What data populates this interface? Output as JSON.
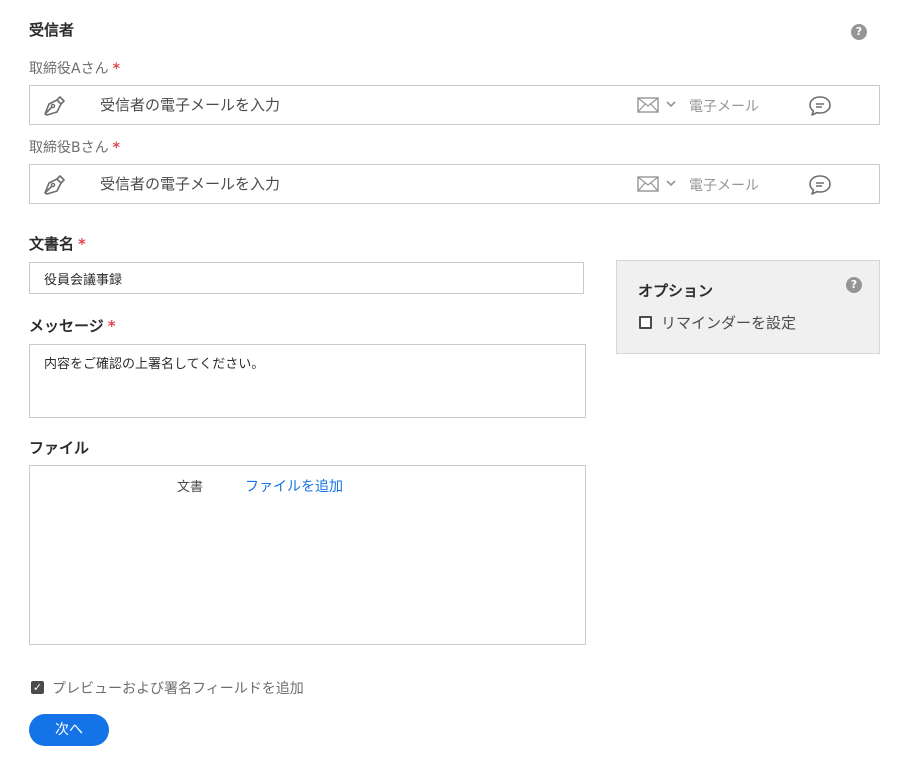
{
  "recipients": {
    "title": "受信者",
    "help_glyph": "?",
    "required_mark": "*",
    "rows": [
      {
        "label": "取締役Aさん",
        "email_placeholder": "受信者の電子メールを入力",
        "email_value": "",
        "auth_method": "電子メール",
        "role_icon": "pen-icon",
        "auth_icon": "mail-icon",
        "message_icon": "chat-bubble-icon"
      },
      {
        "label": "取締役Bさん",
        "email_placeholder": "受信者の電子メールを入力",
        "email_value": "",
        "auth_method": "電子メール",
        "role_icon": "pen-icon",
        "auth_icon": "mail-icon",
        "message_icon": "chat-bubble-icon"
      }
    ]
  },
  "document": {
    "name_label": "文書名",
    "name_value": "役員会議事録",
    "message_label": "メッセージ",
    "message_value": "内容をご確認の上署名してください。",
    "required_mark": "*"
  },
  "files": {
    "label": "ファイル",
    "kind": "文書",
    "add_link": "ファイルを追加"
  },
  "options": {
    "title": "オプション",
    "help_glyph": "?",
    "set_reminder_label": "リマインダーを設定",
    "set_reminder_checked": false
  },
  "footer": {
    "preview_label": "プレビューおよび署名フィールドを追加",
    "preview_checked": true,
    "check_glyph": "✓",
    "next_button": "次へ"
  },
  "colors": {
    "accent": "#1473e6",
    "required": "#e34850",
    "border": "#cacaca",
    "panel_bg": "#f0f0f0"
  }
}
